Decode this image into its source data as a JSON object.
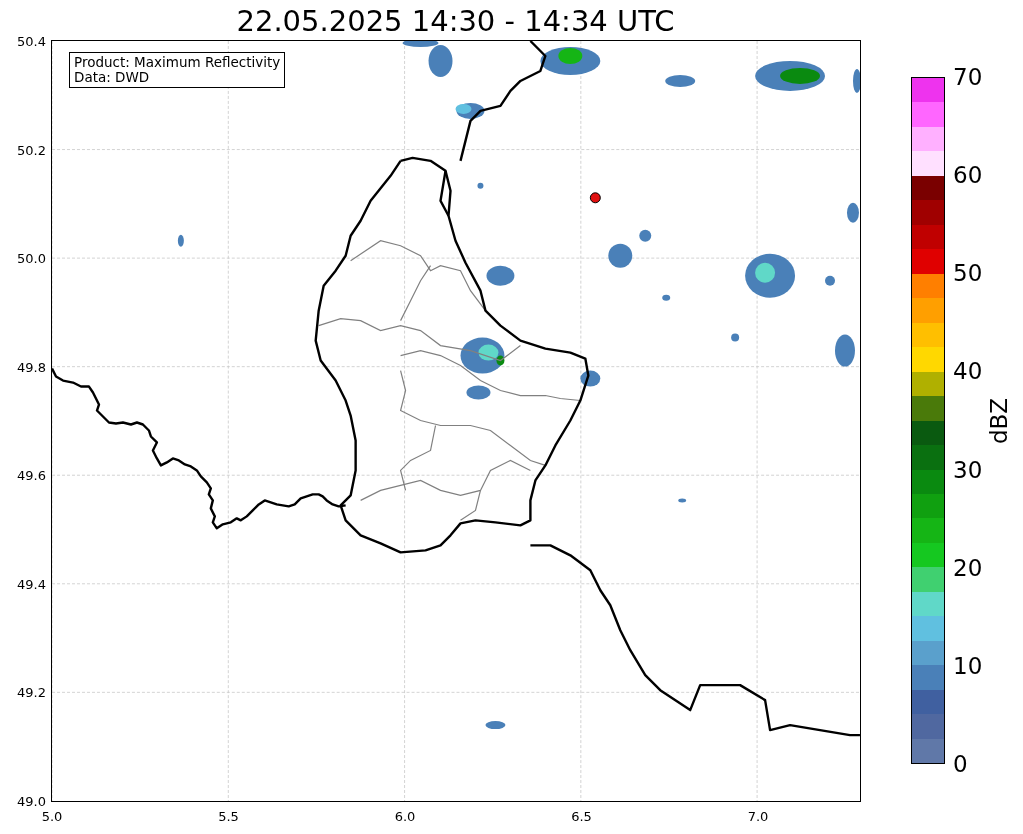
{
  "title": "22.05.2025 14:30 - 14:34 UTC",
  "info_box": {
    "lines": [
      "Product: Maximum Reflectivity",
      "Data: DWD"
    ]
  },
  "map": {
    "y_ticks": [
      "50.4",
      "50.2",
      "50.0",
      "49.8",
      "49.6",
      "49.4",
      "49.2",
      "49.0"
    ],
    "x_ticks": [
      "5.0",
      "5.5",
      "6.0",
      "6.5",
      "7.0"
    ]
  },
  "colorbar": {
    "label": "dBZ",
    "ticks": [
      "70",
      "60",
      "50",
      "40",
      "30",
      "20",
      "10",
      "0"
    ],
    "bands": [
      {
        "color": "#ee33ee"
      },
      {
        "color": "#ff66ff"
      },
      {
        "color": "#ffb0ff"
      },
      {
        "color": "#ffe0ff"
      },
      {
        "color": "#7a0000"
      },
      {
        "color": "#a00000"
      },
      {
        "color": "#c00000"
      },
      {
        "color": "#e00000"
      },
      {
        "color": "#ff7f00"
      },
      {
        "color": "#ff9f00"
      },
      {
        "color": "#ffbf00"
      },
      {
        "color": "#ffd800"
      },
      {
        "color": "#b0b000"
      },
      {
        "color": "#4a7a0a"
      },
      {
        "color": "#0a5a10"
      },
      {
        "color": "#0a7010"
      },
      {
        "color": "#0a8a10"
      },
      {
        "color": "#10a010"
      },
      {
        "color": "#15b515"
      },
      {
        "color": "#15c820"
      },
      {
        "color": "#40d070"
      },
      {
        "color": "#60d8c8"
      },
      {
        "color": "#60c0e0"
      },
      {
        "color": "#5aa0cc"
      },
      {
        "color": "#4a80b8"
      },
      {
        "color": "#4060a0"
      },
      {
        "color": "#5068a0"
      },
      {
        "color": "#6078a8"
      }
    ]
  }
}
